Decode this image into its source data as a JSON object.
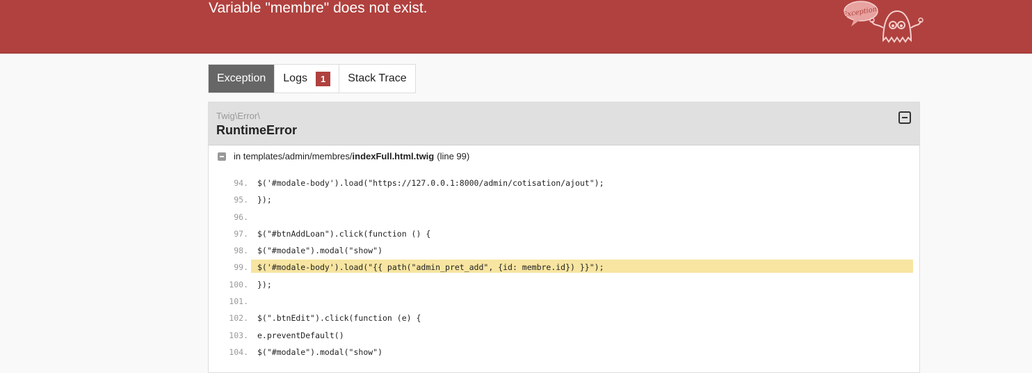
{
  "header": {
    "message": "Variable \"membre\" does not exist.",
    "logo_text": "Exception!"
  },
  "tabs": [
    {
      "label": "Exception",
      "active": true
    },
    {
      "label": "Logs",
      "badge": "1",
      "active": false
    },
    {
      "label": "Stack Trace",
      "active": false
    }
  ],
  "exception": {
    "namespace": "Twig\\Error\\",
    "class": "RuntimeError",
    "trace": {
      "prefix": "in templates/admin/membres/",
      "file": "indexFull.html.twig",
      "line_text": "(line 99)"
    },
    "code_lines": [
      {
        "no": "94.",
        "code": "$('#modale-body').load(\"https://127.0.0.1:8000/admin/cotisation/ajout\");",
        "selected": false
      },
      {
        "no": "95.",
        "code": "});",
        "selected": false
      },
      {
        "no": "96.",
        "code": "",
        "selected": false
      },
      {
        "no": "97.",
        "code": "$(\"#btnAddLoan\").click(function () {",
        "selected": false
      },
      {
        "no": "98.",
        "code": "$(\"#modale\").modal(\"show\")",
        "selected": false
      },
      {
        "no": "99.",
        "code": "$('#modale-body').load(\"{{ path(\"admin_pret_add\", {id: membre.id}) }}\");",
        "selected": true
      },
      {
        "no": "100.",
        "code": "});",
        "selected": false
      },
      {
        "no": "101.",
        "code": "",
        "selected": false
      },
      {
        "no": "102.",
        "code": "$(\".btnEdit\").click(function (e) {",
        "selected": false
      },
      {
        "no": "103.",
        "code": "e.preventDefault()",
        "selected": false
      },
      {
        "no": "104.",
        "code": "$(\"#modale\").modal(\"show\")",
        "selected": false
      }
    ]
  },
  "colors": {
    "header_bg": "#b0413e",
    "badge_bg": "#b0413e",
    "highlight": "#f7e5a1",
    "active_tab": "#666666"
  }
}
